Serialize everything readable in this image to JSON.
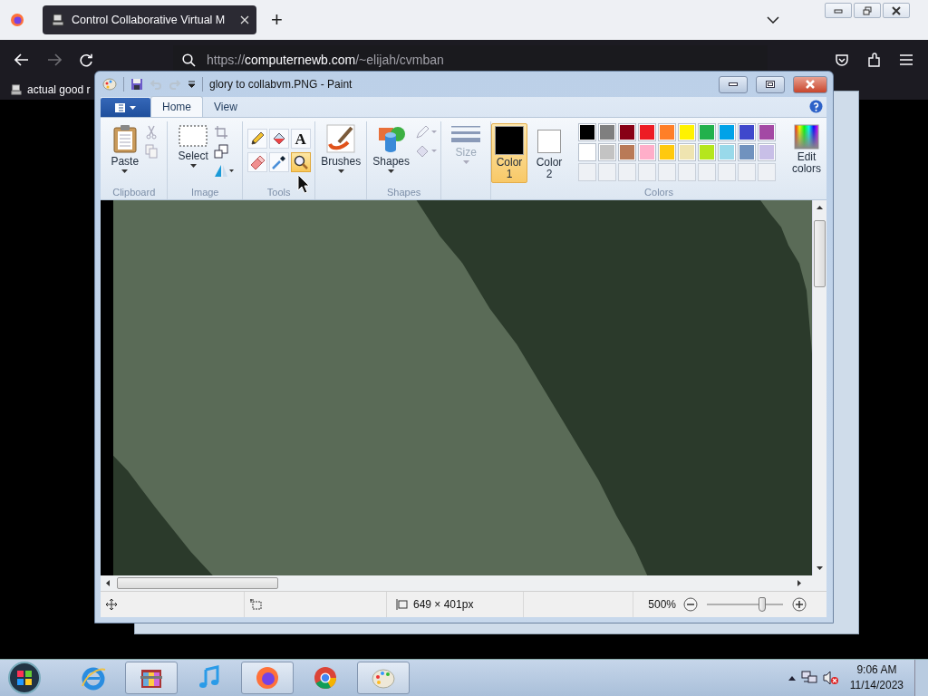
{
  "browser": {
    "tabs": [
      {
        "title": "Control Collaborative Virtual M",
        "selected": true
      }
    ],
    "new_tab": "+",
    "url": {
      "scheme": "https://",
      "domain": "computernewb.com",
      "path": "/~elijah/cvmban"
    },
    "bookmarks": [
      {
        "label": "actual good r"
      }
    ]
  },
  "paint": {
    "title": "glory to collabvm.PNG - Paint",
    "tabs": [
      {
        "label": "Home",
        "selected": true
      },
      {
        "label": "View",
        "selected": false
      }
    ],
    "ribbon": {
      "clipboard": {
        "label": "Clipboard",
        "paste": "Paste"
      },
      "image": {
        "label": "Image",
        "select": "Select"
      },
      "tools": {
        "label": "Tools",
        "items": [
          {
            "kind": "pencil",
            "selected": false
          },
          {
            "kind": "fill",
            "selected": false
          },
          {
            "kind": "text",
            "glyph": "A",
            "selected": false
          },
          {
            "kind": "eraser",
            "selected": false
          },
          {
            "kind": "picker",
            "selected": false
          },
          {
            "kind": "magnifier",
            "selected": true
          }
        ]
      },
      "brushes": {
        "label": "Brushes"
      },
      "shapes": {
        "button": "Shapes",
        "label": "Shapes"
      },
      "size": {
        "label": "Size",
        "disabled": true
      },
      "colors": {
        "label": "Colors",
        "edit": "Edit colors",
        "slots": [
          {
            "label": "Color 1",
            "color": "#000000",
            "selected": true
          },
          {
            "label": "Color 2",
            "color": "#ffffff",
            "selected": false
          }
        ],
        "palette": [
          {
            "kind": "swatch",
            "color": "#000000"
          },
          {
            "kind": "swatch",
            "color": "#7f7f7f"
          },
          {
            "kind": "swatch",
            "color": "#880015"
          },
          {
            "kind": "swatch",
            "color": "#ed1c24"
          },
          {
            "kind": "swatch",
            "color": "#ff7f27"
          },
          {
            "kind": "swatch",
            "color": "#fff200"
          },
          {
            "kind": "swatch",
            "color": "#22b14c"
          },
          {
            "kind": "swatch",
            "color": "#00a2e8"
          },
          {
            "kind": "swatch",
            "color": "#3f48cc"
          },
          {
            "kind": "swatch",
            "color": "#a349a4"
          },
          {
            "kind": "swatch",
            "color": "#ffffff"
          },
          {
            "kind": "swatch",
            "color": "#c3c3c3"
          },
          {
            "kind": "swatch",
            "color": "#b97a57"
          },
          {
            "kind": "swatch",
            "color": "#ffaec9"
          },
          {
            "kind": "swatch",
            "color": "#ffc90e"
          },
          {
            "kind": "swatch",
            "color": "#efe4b0"
          },
          {
            "kind": "swatch",
            "color": "#b5e61d"
          },
          {
            "kind": "swatch",
            "color": "#99d9ea"
          },
          {
            "kind": "swatch",
            "color": "#7092be"
          },
          {
            "kind": "swatch",
            "color": "#c8bfe7"
          },
          {
            "kind": "empty"
          },
          {
            "kind": "empty"
          },
          {
            "kind": "empty"
          },
          {
            "kind": "empty"
          },
          {
            "kind": "empty"
          },
          {
            "kind": "empty"
          },
          {
            "kind": "empty"
          },
          {
            "kind": "empty"
          },
          {
            "kind": "empty"
          },
          {
            "kind": "empty"
          }
        ]
      }
    },
    "status": {
      "size": "649 × 401px",
      "zoom": "500%",
      "zoom_slider": {
        "level": 0.75
      }
    }
  },
  "taskbar": {
    "apps": [
      {
        "kind": "ie",
        "active": false
      },
      {
        "kind": "archive",
        "active": true
      },
      {
        "kind": "music",
        "active": false
      },
      {
        "kind": "firefox",
        "active": true
      },
      {
        "kind": "chrome",
        "active": false
      },
      {
        "kind": "paint",
        "active": true
      }
    ],
    "time": "9:06 AM",
    "date": "11/14/2023"
  }
}
